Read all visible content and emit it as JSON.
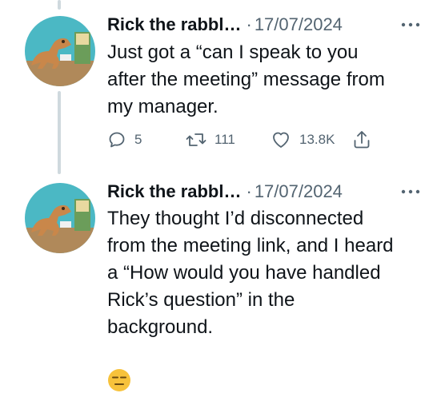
{
  "tweets": [
    {
      "author": "Rick the rabbl…",
      "separator": "·",
      "date": "17/07/2024",
      "text": "Just got a “can I speak to you\nafter the meeting” message from\nmy manager.",
      "replies": "5",
      "retweets": "111",
      "likes": "13.8K"
    },
    {
      "author": "Rick the rabbl…",
      "separator": "·",
      "date": "17/07/2024",
      "text": "They thought I’d disconnected\nfrom the meeting link, and I heard\na “How would you have handled\nRick’s question” in the\nbackground."
    }
  ],
  "icons": {
    "more": "more-horizontal-icon",
    "reply": "reply-icon",
    "retweet": "retweet-icon",
    "like": "heart-icon",
    "share": "share-icon",
    "emoji": "expressionless-face-emoji"
  },
  "colors": {
    "text": "#0f1419",
    "muted": "#536471",
    "thread_line": "#cfd9de",
    "avatar_background": "#4bb8c4",
    "avatar_dinosaur": "#c9874a",
    "emoji_face": "#f7c23b"
  }
}
